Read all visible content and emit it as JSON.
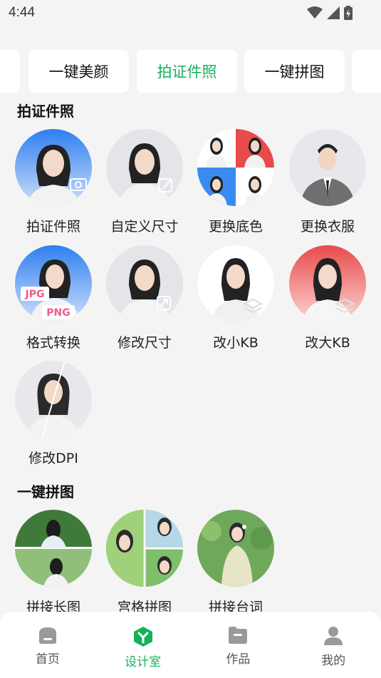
{
  "status_bar": {
    "time": "4:44"
  },
  "top_tabs": [
    {
      "label": "一键美颜",
      "active": false
    },
    {
      "label": "拍证件照",
      "active": true
    },
    {
      "label": "一键拼图",
      "active": false
    }
  ],
  "sections": {
    "id_photo": {
      "title": "拍证件照",
      "tools": [
        {
          "label": "拍证件照"
        },
        {
          "label": "自定义尺寸"
        },
        {
          "label": "更换底色"
        },
        {
          "label": "更换衣服"
        },
        {
          "label": "格式转换",
          "badges": [
            "JPG",
            "PNG"
          ]
        },
        {
          "label": "修改尺寸"
        },
        {
          "label": "改小KB"
        },
        {
          "label": "改大KB"
        },
        {
          "label": "修改DPI"
        }
      ]
    },
    "collage": {
      "title": "一键拼图",
      "tools": [
        {
          "label": "拼接长图"
        },
        {
          "label": "宫格拼图"
        },
        {
          "label": "拼接台词"
        }
      ]
    }
  },
  "bottom_nav": [
    {
      "label": "首页",
      "icon": "home-icon",
      "active": false
    },
    {
      "label": "设计室",
      "icon": "design-icon",
      "active": true
    },
    {
      "label": "作品",
      "icon": "folder-icon",
      "active": false
    },
    {
      "label": "我的",
      "icon": "user-icon",
      "active": false
    }
  ],
  "colors": {
    "accent": "#14b35a",
    "background": "#f4f4f4",
    "red_bg": "#e94a4a",
    "blue_bg": "#3a8af0"
  }
}
